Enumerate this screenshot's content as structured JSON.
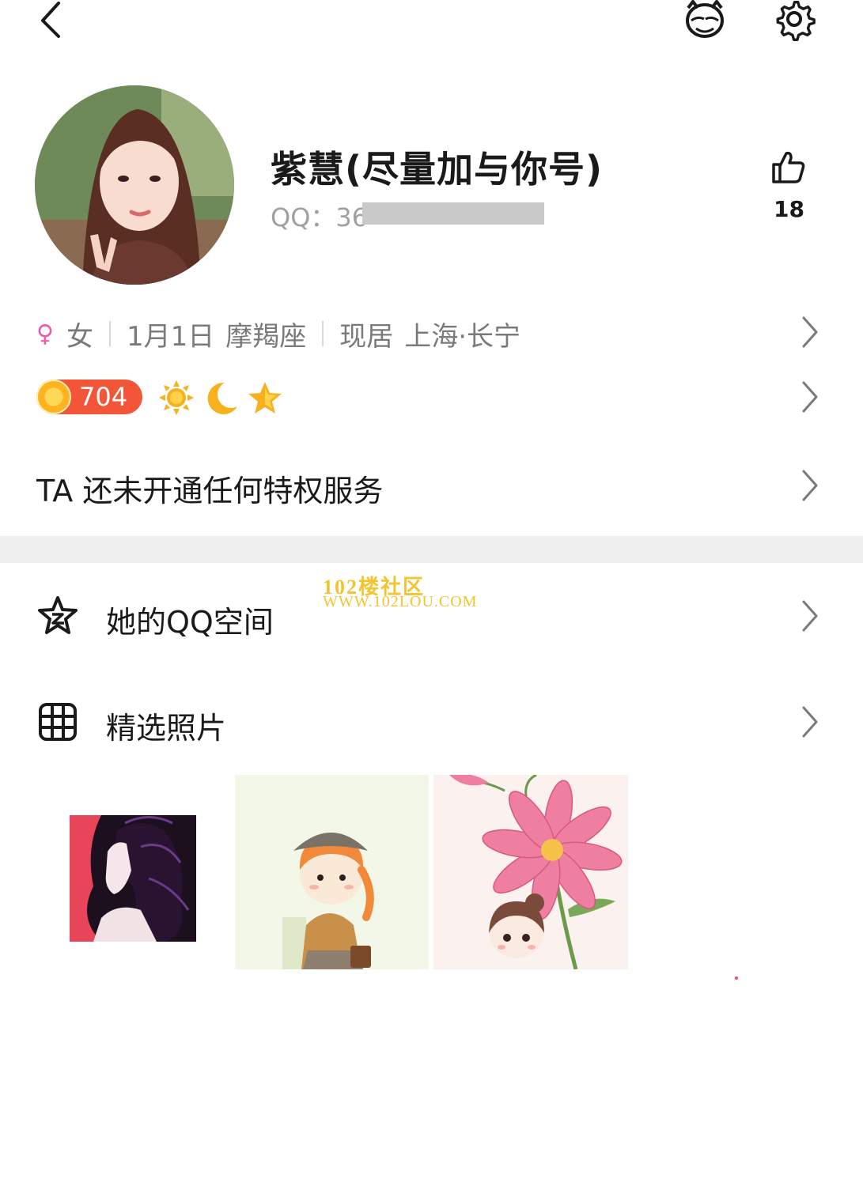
{
  "profile": {
    "nickname": "紫慧(尽量加与你号)",
    "qq_label": "QQ：36",
    "like_count": "18"
  },
  "info": {
    "gender": "女",
    "birthday": "1月1日",
    "zodiac": "摩羯座",
    "residence_label": "现居",
    "residence": "上海·长宁"
  },
  "level": {
    "value": "704",
    "icons": [
      "sun-icon",
      "moon-icon",
      "star-icon"
    ]
  },
  "privilege": {
    "text": "TA 还未开通任何特权服务"
  },
  "watermark": {
    "line1": "102楼社区",
    "line2": "WWW.102LOU.COM"
  },
  "menu": {
    "qzone_label": "她的QQ空间",
    "photos_label": "精选照片"
  },
  "colors": {
    "female": "#e95aa8",
    "level_badge": "#f25538",
    "watermark": "#f2c430",
    "divider": "#efefef"
  }
}
